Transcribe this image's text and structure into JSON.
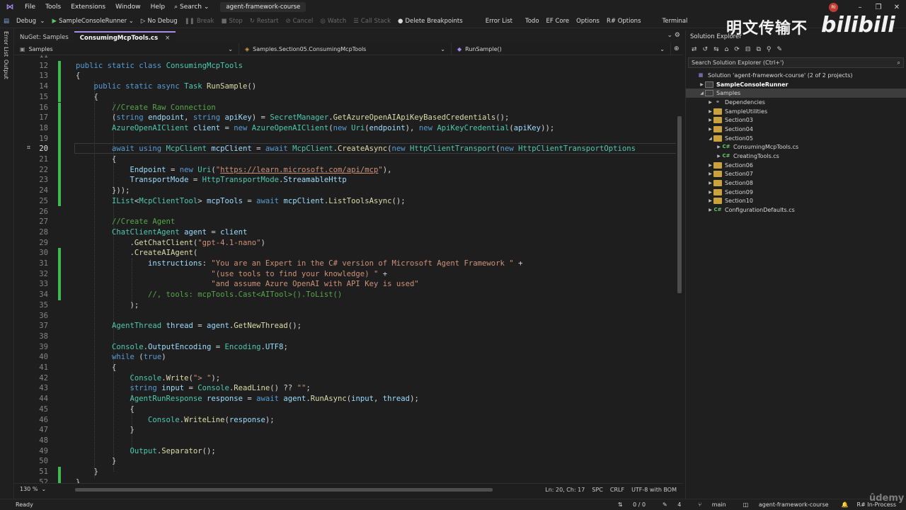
{
  "menu": {
    "items": [
      "File",
      "Tools",
      "Extensions",
      "Window",
      "Help"
    ],
    "search": "Search",
    "solution_name": "agent-framework-course",
    "avatar": "RI"
  },
  "toolbar": {
    "config": "Debug",
    "run_target": "SampleConsoleRunner",
    "no_debug": "No Debug",
    "break": "Break",
    "stop": "Stop",
    "restart": "Restart",
    "cancel": "Cancel",
    "watch": "Watch",
    "call_stack": "Call Stack",
    "delete_breakpoints": "Delete Breakpoints",
    "error_list": "Error List",
    "todo": "Todo",
    "ef_core": "EF Core",
    "options": "Options",
    "rsharp_options": "R# Options",
    "terminal": "Terminal"
  },
  "side_tabs": [
    "Error List",
    "Output"
  ],
  "doc_tabs": [
    {
      "label": "NuGet: Samples"
    },
    {
      "label": "ConsumingMcpTools.cs",
      "close": "×"
    }
  ],
  "nav": {
    "project": "Samples",
    "class": "Samples.Section05.ConsumingMcpTools",
    "method": "RunSample()"
  },
  "code_lines": [
    {
      "n": "11",
      "tokens": []
    },
    {
      "n": "12",
      "tokens": [
        [
          "k",
          "public static class "
        ],
        [
          "t",
          "ConsumingMcpTools"
        ]
      ]
    },
    {
      "n": "13",
      "tokens": [
        [
          "p",
          "{"
        ]
      ]
    },
    {
      "n": "14",
      "tokens": [
        [
          "k",
          "    public static async "
        ],
        [
          "t",
          "Task "
        ],
        [
          "m",
          "RunSample"
        ],
        [
          "p",
          "()"
        ]
      ]
    },
    {
      "n": "15",
      "tokens": [
        [
          "p",
          "    {"
        ]
      ]
    },
    {
      "n": "16",
      "tokens": [
        [
          "c",
          "        //Create Raw Connection"
        ]
      ]
    },
    {
      "n": "17",
      "tokens": [
        [
          "p",
          "        ("
        ],
        [
          "k",
          "string "
        ],
        [
          "v",
          "endpoint"
        ],
        [
          "p",
          ", "
        ],
        [
          "k",
          "string "
        ],
        [
          "v",
          "apiKey"
        ],
        [
          "p",
          ") = "
        ],
        [
          "t",
          "SecretManager"
        ],
        [
          "p",
          "."
        ],
        [
          "m",
          "GetAzureOpenAIApiKeyBasedCredentials"
        ],
        [
          "p",
          "();"
        ]
      ]
    },
    {
      "n": "18",
      "tokens": [
        [
          "t",
          "        AzureOpenAIClient "
        ],
        [
          "v",
          "client"
        ],
        [
          "p",
          " = "
        ],
        [
          "k",
          "new "
        ],
        [
          "t",
          "AzureOpenAIClient"
        ],
        [
          "p",
          "("
        ],
        [
          "k",
          "new "
        ],
        [
          "t",
          "Uri"
        ],
        [
          "p",
          "("
        ],
        [
          "v",
          "endpoint"
        ],
        [
          "p",
          "), "
        ],
        [
          "k",
          "new "
        ],
        [
          "t",
          "ApiKeyCredential"
        ],
        [
          "p",
          "("
        ],
        [
          "v",
          "apiKey"
        ],
        [
          "p",
          "));"
        ]
      ]
    },
    {
      "n": "19",
      "tokens": []
    },
    {
      "n": "20",
      "tokens": [
        [
          "k",
          "        await using "
        ],
        [
          "t",
          "McpClient "
        ],
        [
          "v",
          "mcpClient"
        ],
        [
          "p",
          " = "
        ],
        [
          "k",
          "await "
        ],
        [
          "t",
          "McpClient"
        ],
        [
          "p",
          "."
        ],
        [
          "m",
          "CreateAsync"
        ],
        [
          "p",
          "("
        ],
        [
          "k",
          "new "
        ],
        [
          "t",
          "HttpClientTransport"
        ],
        [
          "p",
          "("
        ],
        [
          "k",
          "new "
        ],
        [
          "t",
          "HttpClientTransportOptions"
        ]
      ]
    },
    {
      "n": "21",
      "tokens": [
        [
          "p",
          "        {"
        ]
      ]
    },
    {
      "n": "22",
      "tokens": [
        [
          "v",
          "            Endpoint"
        ],
        [
          "p",
          " = "
        ],
        [
          "k",
          "new "
        ],
        [
          "t",
          "Uri"
        ],
        [
          "p",
          "("
        ],
        [
          "s",
          "\""
        ],
        [
          "u",
          "https://learn.microsoft.com/api/mcp"
        ],
        [
          "s",
          "\""
        ],
        [
          "p",
          "),"
        ]
      ]
    },
    {
      "n": "23",
      "tokens": [
        [
          "v",
          "            TransportMode"
        ],
        [
          "p",
          " = "
        ],
        [
          "t",
          "HttpTransportMode"
        ],
        [
          "p",
          "."
        ],
        [
          "v",
          "StreamableHttp"
        ]
      ]
    },
    {
      "n": "24",
      "tokens": [
        [
          "p",
          "        }));"
        ]
      ]
    },
    {
      "n": "25",
      "tokens": [
        [
          "t",
          "        IList"
        ],
        [
          "p",
          "<"
        ],
        [
          "t",
          "McpClientTool"
        ],
        [
          "p",
          "> "
        ],
        [
          "v",
          "mcpTools"
        ],
        [
          "p",
          " = "
        ],
        [
          "k",
          "await "
        ],
        [
          "v",
          "mcpClient"
        ],
        [
          "p",
          "."
        ],
        [
          "m",
          "ListToolsAsync"
        ],
        [
          "p",
          "();"
        ]
      ]
    },
    {
      "n": "26",
      "tokens": []
    },
    {
      "n": "27",
      "tokens": [
        [
          "c",
          "        //Create Agent"
        ]
      ]
    },
    {
      "n": "28",
      "tokens": [
        [
          "t",
          "        ChatClientAgent "
        ],
        [
          "v",
          "agent"
        ],
        [
          "p",
          " = "
        ],
        [
          "v",
          "client"
        ]
      ]
    },
    {
      "n": "29",
      "tokens": [
        [
          "p",
          "            ."
        ],
        [
          "m",
          "GetChatClient"
        ],
        [
          "p",
          "("
        ],
        [
          "s",
          "\"gpt-4.1-nano\""
        ],
        [
          "p",
          ")"
        ]
      ]
    },
    {
      "n": "30",
      "tokens": [
        [
          "p",
          "            ."
        ],
        [
          "m",
          "CreateAIAgent"
        ],
        [
          "p",
          "("
        ]
      ]
    },
    {
      "n": "31",
      "tokens": [
        [
          "v",
          "                instructions"
        ],
        [
          "p",
          ": "
        ],
        [
          "s",
          "\"You are an Expert in the C# version of Microsoft Agent Framework \""
        ],
        [
          "p",
          " +"
        ]
      ]
    },
    {
      "n": "32",
      "tokens": [
        [
          "s",
          "                              \"(use tools to find your knowledge) \""
        ],
        [
          "p",
          " +"
        ]
      ]
    },
    {
      "n": "33",
      "tokens": [
        [
          "s",
          "                              \"and assume Azure OpenAI with API Key is used\""
        ]
      ]
    },
    {
      "n": "34",
      "tokens": [
        [
          "c",
          "                //, tools: mcpTools.Cast<AITool>().ToList()"
        ]
      ]
    },
    {
      "n": "35",
      "tokens": [
        [
          "p",
          "            );"
        ]
      ]
    },
    {
      "n": "36",
      "tokens": []
    },
    {
      "n": "37",
      "tokens": [
        [
          "t",
          "        AgentThread "
        ],
        [
          "v",
          "thread"
        ],
        [
          "p",
          " = "
        ],
        [
          "v",
          "agent"
        ],
        [
          "p",
          "."
        ],
        [
          "m",
          "GetNewThread"
        ],
        [
          "p",
          "();"
        ]
      ]
    },
    {
      "n": "38",
      "tokens": []
    },
    {
      "n": "39",
      "tokens": [
        [
          "t",
          "        Console"
        ],
        [
          "p",
          "."
        ],
        [
          "v",
          "OutputEncoding"
        ],
        [
          "p",
          " = "
        ],
        [
          "t",
          "Encoding"
        ],
        [
          "p",
          "."
        ],
        [
          "v",
          "UTF8"
        ],
        [
          "p",
          ";"
        ]
      ]
    },
    {
      "n": "40",
      "tokens": [
        [
          "k",
          "        while "
        ],
        [
          "p",
          "("
        ],
        [
          "k",
          "true"
        ],
        [
          "p",
          ")"
        ]
      ]
    },
    {
      "n": "41",
      "tokens": [
        [
          "p",
          "        {"
        ]
      ]
    },
    {
      "n": "42",
      "tokens": [
        [
          "t",
          "            Console"
        ],
        [
          "p",
          "."
        ],
        [
          "m",
          "Write"
        ],
        [
          "p",
          "("
        ],
        [
          "s",
          "\"> \""
        ],
        [
          "p",
          ");"
        ]
      ]
    },
    {
      "n": "43",
      "tokens": [
        [
          "k",
          "            string "
        ],
        [
          "v",
          "input"
        ],
        [
          "p",
          " = "
        ],
        [
          "t",
          "Console"
        ],
        [
          "p",
          "."
        ],
        [
          "m",
          "ReadLine"
        ],
        [
          "p",
          "() ?? "
        ],
        [
          "s",
          "\"\""
        ],
        [
          "p",
          ";"
        ]
      ]
    },
    {
      "n": "44",
      "tokens": [
        [
          "t",
          "            AgentRunResponse "
        ],
        [
          "v",
          "response"
        ],
        [
          "p",
          " = "
        ],
        [
          "k",
          "await "
        ],
        [
          "v",
          "agent"
        ],
        [
          "p",
          "."
        ],
        [
          "m",
          "RunAsync"
        ],
        [
          "p",
          "("
        ],
        [
          "v",
          "input"
        ],
        [
          "p",
          ", "
        ],
        [
          "v",
          "thread"
        ],
        [
          "p",
          ");"
        ]
      ]
    },
    {
      "n": "45",
      "tokens": [
        [
          "p",
          "            {"
        ]
      ]
    },
    {
      "n": "46",
      "tokens": [
        [
          "t",
          "                Console"
        ],
        [
          "p",
          "."
        ],
        [
          "m",
          "WriteLine"
        ],
        [
          "p",
          "("
        ],
        [
          "v",
          "response"
        ],
        [
          "p",
          ");"
        ]
      ]
    },
    {
      "n": "47",
      "tokens": [
        [
          "p",
          "            }"
        ]
      ]
    },
    {
      "n": "48",
      "tokens": []
    },
    {
      "n": "49",
      "tokens": [
        [
          "t",
          "            Output"
        ],
        [
          "p",
          "."
        ],
        [
          "m",
          "Separator"
        ],
        [
          "p",
          "();"
        ]
      ]
    },
    {
      "n": "50",
      "tokens": [
        [
          "p",
          "        }"
        ]
      ]
    },
    {
      "n": "51",
      "tokens": [
        [
          "p",
          "    }"
        ]
      ]
    },
    {
      "n": "52",
      "tokens": [
        [
          "p",
          "}"
        ]
      ]
    }
  ],
  "editor_status": {
    "zoom": "130 %",
    "position": "Ln: 20, Ch: 17",
    "spc": "SPC",
    "crlf": "CRLF",
    "encoding": "UTF-8 with BOM"
  },
  "solution_explorer": {
    "title": "Solution Explorer",
    "search_placeholder": "Search Solution Explorer (Ctrl+')",
    "nodes": [
      {
        "label": "Solution 'agent-framework-course' (2 of 2 projects)",
        "indent": 0,
        "arrow": "",
        "icon": "sln"
      },
      {
        "label": "SampleConsoleRunner",
        "indent": 1,
        "arrow": "▶",
        "icon": "proj",
        "bold": true
      },
      {
        "label": "Samples",
        "indent": 1,
        "arrow": "◢",
        "icon": "proj",
        "selected": true
      },
      {
        "label": "Dependencies",
        "indent": 2,
        "arrow": "▶",
        "icon": "dep"
      },
      {
        "label": "SampleUtilities",
        "indent": 2,
        "arrow": "▶",
        "icon": "folder"
      },
      {
        "label": "Section03",
        "indent": 2,
        "arrow": "▶",
        "icon": "folder"
      },
      {
        "label": "Section04",
        "indent": 2,
        "arrow": "▶",
        "icon": "folder"
      },
      {
        "label": "Section05",
        "indent": 2,
        "arrow": "◢",
        "icon": "folder"
      },
      {
        "label": "ConsumingMcpTools.cs",
        "indent": 3,
        "arrow": "▶",
        "icon": "cs"
      },
      {
        "label": "CreatingTools.cs",
        "indent": 3,
        "arrow": "▶",
        "icon": "cs"
      },
      {
        "label": "Section06",
        "indent": 2,
        "arrow": "▶",
        "icon": "folder"
      },
      {
        "label": "Section07",
        "indent": 2,
        "arrow": "▶",
        "icon": "folder"
      },
      {
        "label": "Section08",
        "indent": 2,
        "arrow": "▶",
        "icon": "folder"
      },
      {
        "label": "Section09",
        "indent": 2,
        "arrow": "▶",
        "icon": "folder"
      },
      {
        "label": "Section10",
        "indent": 2,
        "arrow": "▶",
        "icon": "folder"
      },
      {
        "label": "ConfigurationDefaults.cs",
        "indent": 2,
        "arrow": "▶",
        "icon": "cs"
      }
    ]
  },
  "watermark": {
    "text": "明文传输不",
    "logo": "bilibili"
  },
  "statusbar": {
    "ready": "Ready",
    "arrows": "0 / 0",
    "pencil": "4",
    "branch": "main",
    "repo": "agent-framework-course",
    "rsharp": "R# In-Process"
  },
  "udemy": "ûdemy",
  "colors": {
    "accent": "#a98ae8",
    "change_bar": "#3fb950",
    "editor_bg": "#1e1e1e"
  }
}
